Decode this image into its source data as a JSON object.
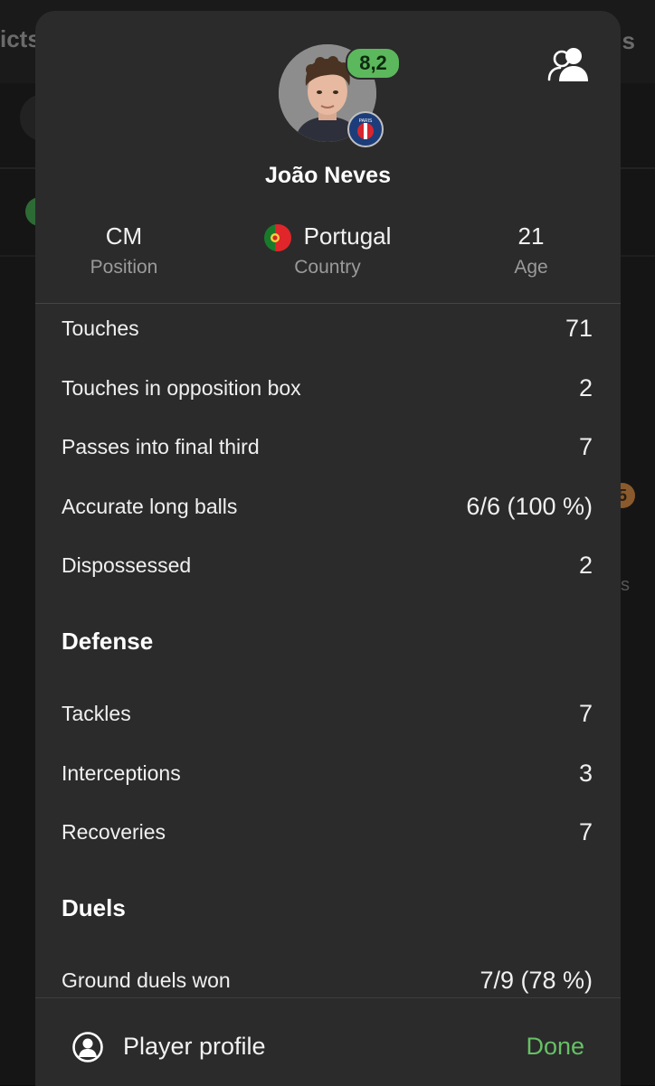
{
  "background": {
    "tab_left": "icts",
    "tab_right": "s",
    "badge_text": "5",
    "side_letter": "s"
  },
  "player": {
    "name": "João Neves",
    "rating": "8,2",
    "club": "PARIS"
  },
  "info": [
    {
      "value": "CM",
      "label": "Position"
    },
    {
      "value": "Portugal",
      "label": "Country"
    },
    {
      "value": "21",
      "label": "Age"
    }
  ],
  "stats": [
    {
      "label": "Touches",
      "value": "71"
    },
    {
      "label": "Touches in opposition box",
      "value": "2"
    },
    {
      "label": "Passes into final third",
      "value": "7"
    },
    {
      "label": "Accurate long balls",
      "value": "6/6 (100 %)"
    },
    {
      "label": "Dispossessed",
      "value": "2"
    }
  ],
  "defense": {
    "title": "Defense",
    "rows": [
      {
        "label": "Tackles",
        "value": "7"
      },
      {
        "label": "Interceptions",
        "value": "3"
      },
      {
        "label": "Recoveries",
        "value": "7"
      }
    ]
  },
  "duels": {
    "title": "Duels",
    "rows": [
      {
        "label": "Ground duels won",
        "value": "7/9 (78 %)"
      }
    ]
  },
  "footer": {
    "profile_label": "Player profile",
    "done_label": "Done"
  },
  "colors": {
    "sheet_bg": "#2b2b2b",
    "rating_green": "#5cb85c",
    "done_green": "#66c065"
  },
  "icons": [
    "compare-players-icon",
    "person-circle-icon"
  ]
}
